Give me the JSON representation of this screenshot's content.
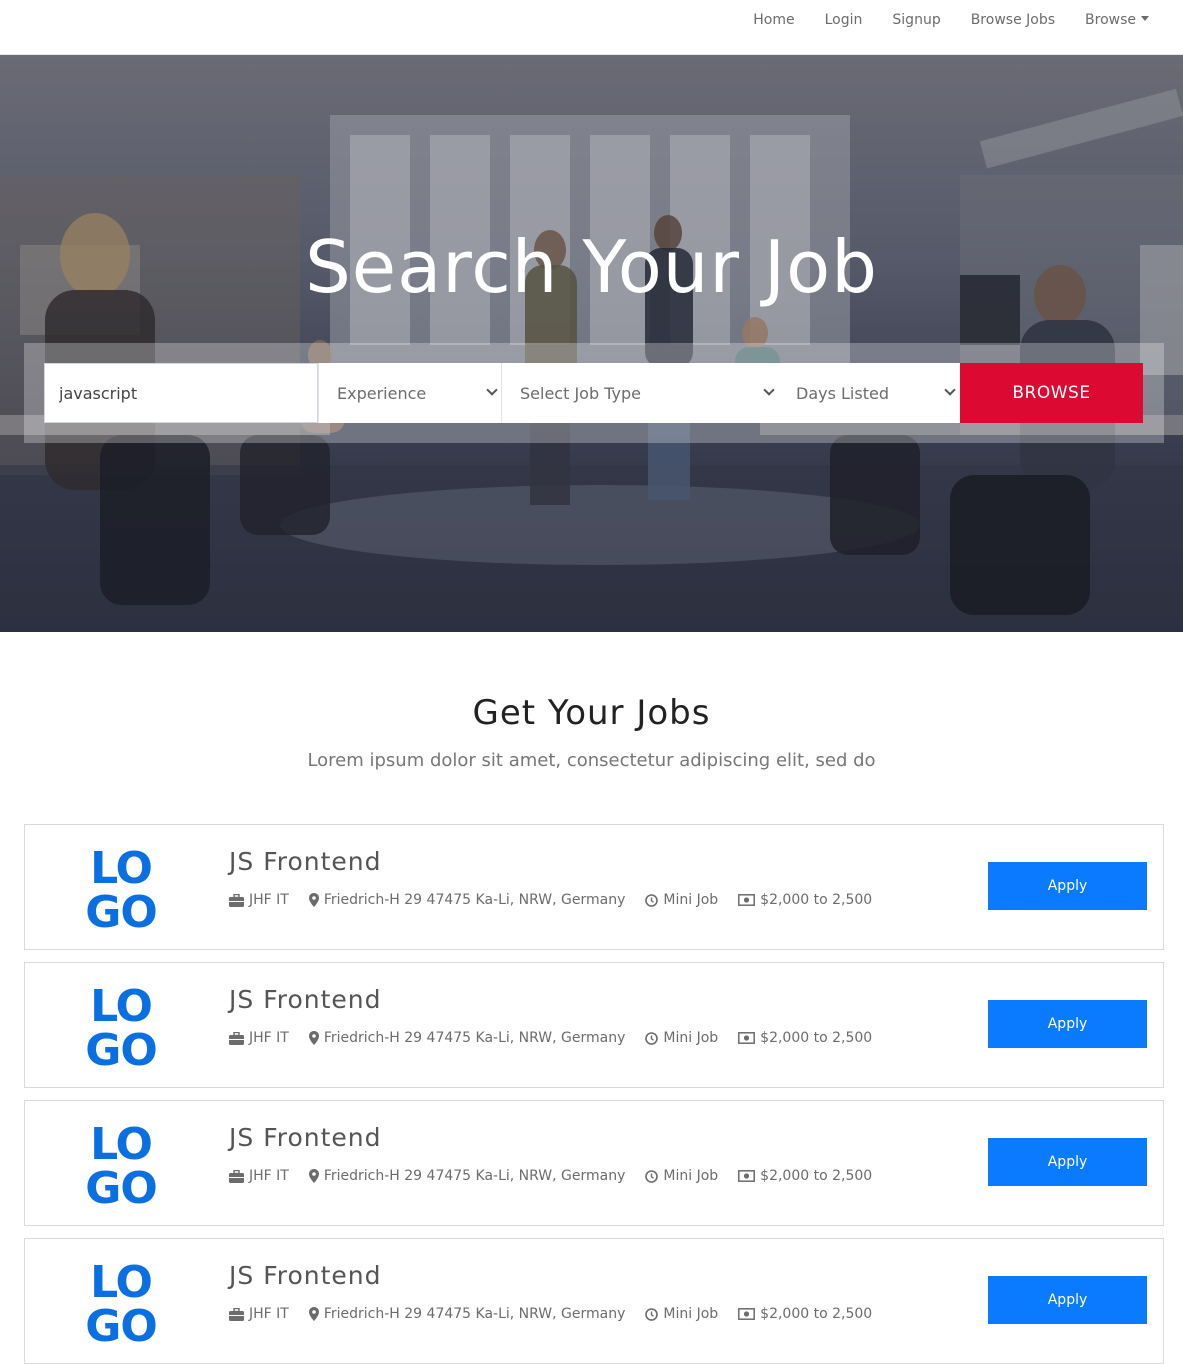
{
  "nav": {
    "links": [
      "Home",
      "Login",
      "Signup",
      "Browse Jobs"
    ],
    "dropdown_label": "Browse"
  },
  "hero": {
    "title": "Search Your Job",
    "search_value": "javascript",
    "experience_select": "Experience",
    "job_type_select": "Select Job Type",
    "days_listed_select": "Days Listed",
    "browse_button": "BROWSE"
  },
  "section": {
    "title": "Get Your Jobs",
    "subtitle": "Lorem ipsum dolor sit amet, consectetur adipiscing elit, sed do"
  },
  "jobs": [
    {
      "title": "JS Frontend",
      "company": "JHF IT",
      "location": "Friedrich-H 29 47475 Ka-Li, NRW, Germany",
      "type": "Mini Job",
      "salary": "$2,000 to 2,500",
      "apply": "Apply"
    },
    {
      "title": "JS Frontend",
      "company": "JHF IT",
      "location": "Friedrich-H 29 47475 Ka-Li, NRW, Germany",
      "type": "Mini Job",
      "salary": "$2,000 to 2,500",
      "apply": "Apply"
    },
    {
      "title": "JS Frontend",
      "company": "JHF IT",
      "location": "Friedrich-H 29 47475 Ka-Li, NRW, Germany",
      "type": "Mini Job",
      "salary": "$2,000 to 2,500",
      "apply": "Apply"
    },
    {
      "title": "JS Frontend",
      "company": "JHF IT",
      "location": "Friedrich-H 29 47475 Ka-Li, NRW, Germany",
      "type": "Mini Job",
      "salary": "$2,000 to 2,500",
      "apply": "Apply"
    }
  ],
  "logo_text": [
    "LO",
    "GO"
  ],
  "colors": {
    "browse": "#dc0a33",
    "apply": "#0a7bff",
    "logo": "#0a6fe0"
  },
  "icons": {
    "company": "briefcase-icon",
    "location": "map-marker-icon",
    "type": "clock-icon",
    "salary": "money-icon"
  }
}
